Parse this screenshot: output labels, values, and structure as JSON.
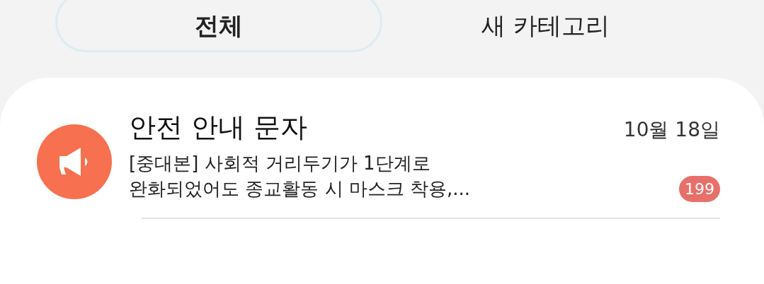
{
  "tabs": [
    {
      "label": "전체",
      "selected": true
    },
    {
      "label": "새 카테고리",
      "selected": false
    }
  ],
  "conversations": [
    {
      "title": "안전 안내 문자",
      "date": "10월 18일",
      "message": "[중대본] 사회적 거리두기가 1단계로\n완화되었어도 종교활동 시 마스크 착용,...",
      "unread": "199",
      "color": "#f7704f"
    }
  ]
}
